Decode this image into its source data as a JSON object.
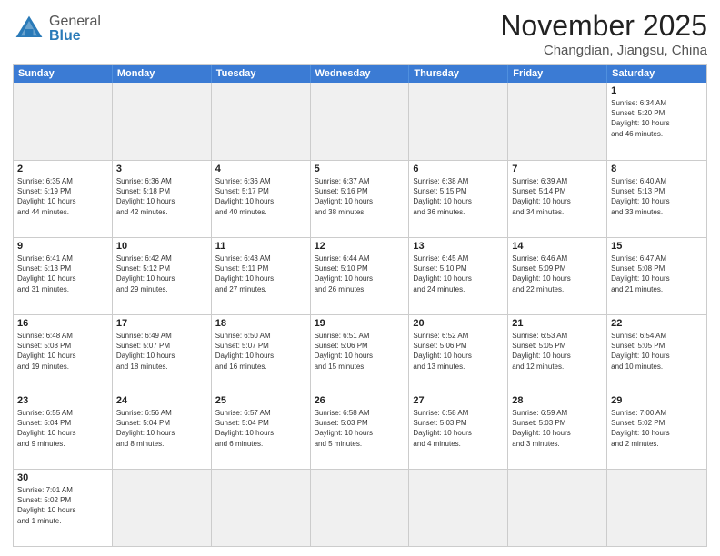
{
  "header": {
    "logo_general": "General",
    "logo_blue": "Blue",
    "title": "November 2025",
    "location": "Changdian, Jiangsu, China"
  },
  "weekdays": [
    "Sunday",
    "Monday",
    "Tuesday",
    "Wednesday",
    "Thursday",
    "Friday",
    "Saturday"
  ],
  "weeks": [
    [
      {
        "day": "",
        "info": "",
        "empty": true
      },
      {
        "day": "",
        "info": "",
        "empty": true
      },
      {
        "day": "",
        "info": "",
        "empty": true
      },
      {
        "day": "",
        "info": "",
        "empty": true
      },
      {
        "day": "",
        "info": "",
        "empty": true
      },
      {
        "day": "",
        "info": "",
        "empty": true
      },
      {
        "day": "1",
        "info": "Sunrise: 6:34 AM\nSunset: 5:20 PM\nDaylight: 10 hours\nand 46 minutes.",
        "empty": false
      }
    ],
    [
      {
        "day": "2",
        "info": "Sunrise: 6:35 AM\nSunset: 5:19 PM\nDaylight: 10 hours\nand 44 minutes.",
        "empty": false
      },
      {
        "day": "3",
        "info": "Sunrise: 6:36 AM\nSunset: 5:18 PM\nDaylight: 10 hours\nand 42 minutes.",
        "empty": false
      },
      {
        "day": "4",
        "info": "Sunrise: 6:36 AM\nSunset: 5:17 PM\nDaylight: 10 hours\nand 40 minutes.",
        "empty": false
      },
      {
        "day": "5",
        "info": "Sunrise: 6:37 AM\nSunset: 5:16 PM\nDaylight: 10 hours\nand 38 minutes.",
        "empty": false
      },
      {
        "day": "6",
        "info": "Sunrise: 6:38 AM\nSunset: 5:15 PM\nDaylight: 10 hours\nand 36 minutes.",
        "empty": false
      },
      {
        "day": "7",
        "info": "Sunrise: 6:39 AM\nSunset: 5:14 PM\nDaylight: 10 hours\nand 34 minutes.",
        "empty": false
      },
      {
        "day": "8",
        "info": "Sunrise: 6:40 AM\nSunset: 5:13 PM\nDaylight: 10 hours\nand 33 minutes.",
        "empty": false
      }
    ],
    [
      {
        "day": "9",
        "info": "Sunrise: 6:41 AM\nSunset: 5:13 PM\nDaylight: 10 hours\nand 31 minutes.",
        "empty": false
      },
      {
        "day": "10",
        "info": "Sunrise: 6:42 AM\nSunset: 5:12 PM\nDaylight: 10 hours\nand 29 minutes.",
        "empty": false
      },
      {
        "day": "11",
        "info": "Sunrise: 6:43 AM\nSunset: 5:11 PM\nDaylight: 10 hours\nand 27 minutes.",
        "empty": false
      },
      {
        "day": "12",
        "info": "Sunrise: 6:44 AM\nSunset: 5:10 PM\nDaylight: 10 hours\nand 26 minutes.",
        "empty": false
      },
      {
        "day": "13",
        "info": "Sunrise: 6:45 AM\nSunset: 5:10 PM\nDaylight: 10 hours\nand 24 minutes.",
        "empty": false
      },
      {
        "day": "14",
        "info": "Sunrise: 6:46 AM\nSunset: 5:09 PM\nDaylight: 10 hours\nand 22 minutes.",
        "empty": false
      },
      {
        "day": "15",
        "info": "Sunrise: 6:47 AM\nSunset: 5:08 PM\nDaylight: 10 hours\nand 21 minutes.",
        "empty": false
      }
    ],
    [
      {
        "day": "16",
        "info": "Sunrise: 6:48 AM\nSunset: 5:08 PM\nDaylight: 10 hours\nand 19 minutes.",
        "empty": false
      },
      {
        "day": "17",
        "info": "Sunrise: 6:49 AM\nSunset: 5:07 PM\nDaylight: 10 hours\nand 18 minutes.",
        "empty": false
      },
      {
        "day": "18",
        "info": "Sunrise: 6:50 AM\nSunset: 5:07 PM\nDaylight: 10 hours\nand 16 minutes.",
        "empty": false
      },
      {
        "day": "19",
        "info": "Sunrise: 6:51 AM\nSunset: 5:06 PM\nDaylight: 10 hours\nand 15 minutes.",
        "empty": false
      },
      {
        "day": "20",
        "info": "Sunrise: 6:52 AM\nSunset: 5:06 PM\nDaylight: 10 hours\nand 13 minutes.",
        "empty": false
      },
      {
        "day": "21",
        "info": "Sunrise: 6:53 AM\nSunset: 5:05 PM\nDaylight: 10 hours\nand 12 minutes.",
        "empty": false
      },
      {
        "day": "22",
        "info": "Sunrise: 6:54 AM\nSunset: 5:05 PM\nDaylight: 10 hours\nand 10 minutes.",
        "empty": false
      }
    ],
    [
      {
        "day": "23",
        "info": "Sunrise: 6:55 AM\nSunset: 5:04 PM\nDaylight: 10 hours\nand 9 minutes.",
        "empty": false
      },
      {
        "day": "24",
        "info": "Sunrise: 6:56 AM\nSunset: 5:04 PM\nDaylight: 10 hours\nand 8 minutes.",
        "empty": false
      },
      {
        "day": "25",
        "info": "Sunrise: 6:57 AM\nSunset: 5:04 PM\nDaylight: 10 hours\nand 6 minutes.",
        "empty": false
      },
      {
        "day": "26",
        "info": "Sunrise: 6:58 AM\nSunset: 5:03 PM\nDaylight: 10 hours\nand 5 minutes.",
        "empty": false
      },
      {
        "day": "27",
        "info": "Sunrise: 6:58 AM\nSunset: 5:03 PM\nDaylight: 10 hours\nand 4 minutes.",
        "empty": false
      },
      {
        "day": "28",
        "info": "Sunrise: 6:59 AM\nSunset: 5:03 PM\nDaylight: 10 hours\nand 3 minutes.",
        "empty": false
      },
      {
        "day": "29",
        "info": "Sunrise: 7:00 AM\nSunset: 5:02 PM\nDaylight: 10 hours\nand 2 minutes.",
        "empty": false
      }
    ],
    [
      {
        "day": "30",
        "info": "Sunrise: 7:01 AM\nSunset: 5:02 PM\nDaylight: 10 hours\nand 1 minute.",
        "empty": false
      },
      {
        "day": "",
        "info": "",
        "empty": true
      },
      {
        "day": "",
        "info": "",
        "empty": true
      },
      {
        "day": "",
        "info": "",
        "empty": true
      },
      {
        "day": "",
        "info": "",
        "empty": true
      },
      {
        "day": "",
        "info": "",
        "empty": true
      },
      {
        "day": "",
        "info": "",
        "empty": true
      }
    ]
  ]
}
